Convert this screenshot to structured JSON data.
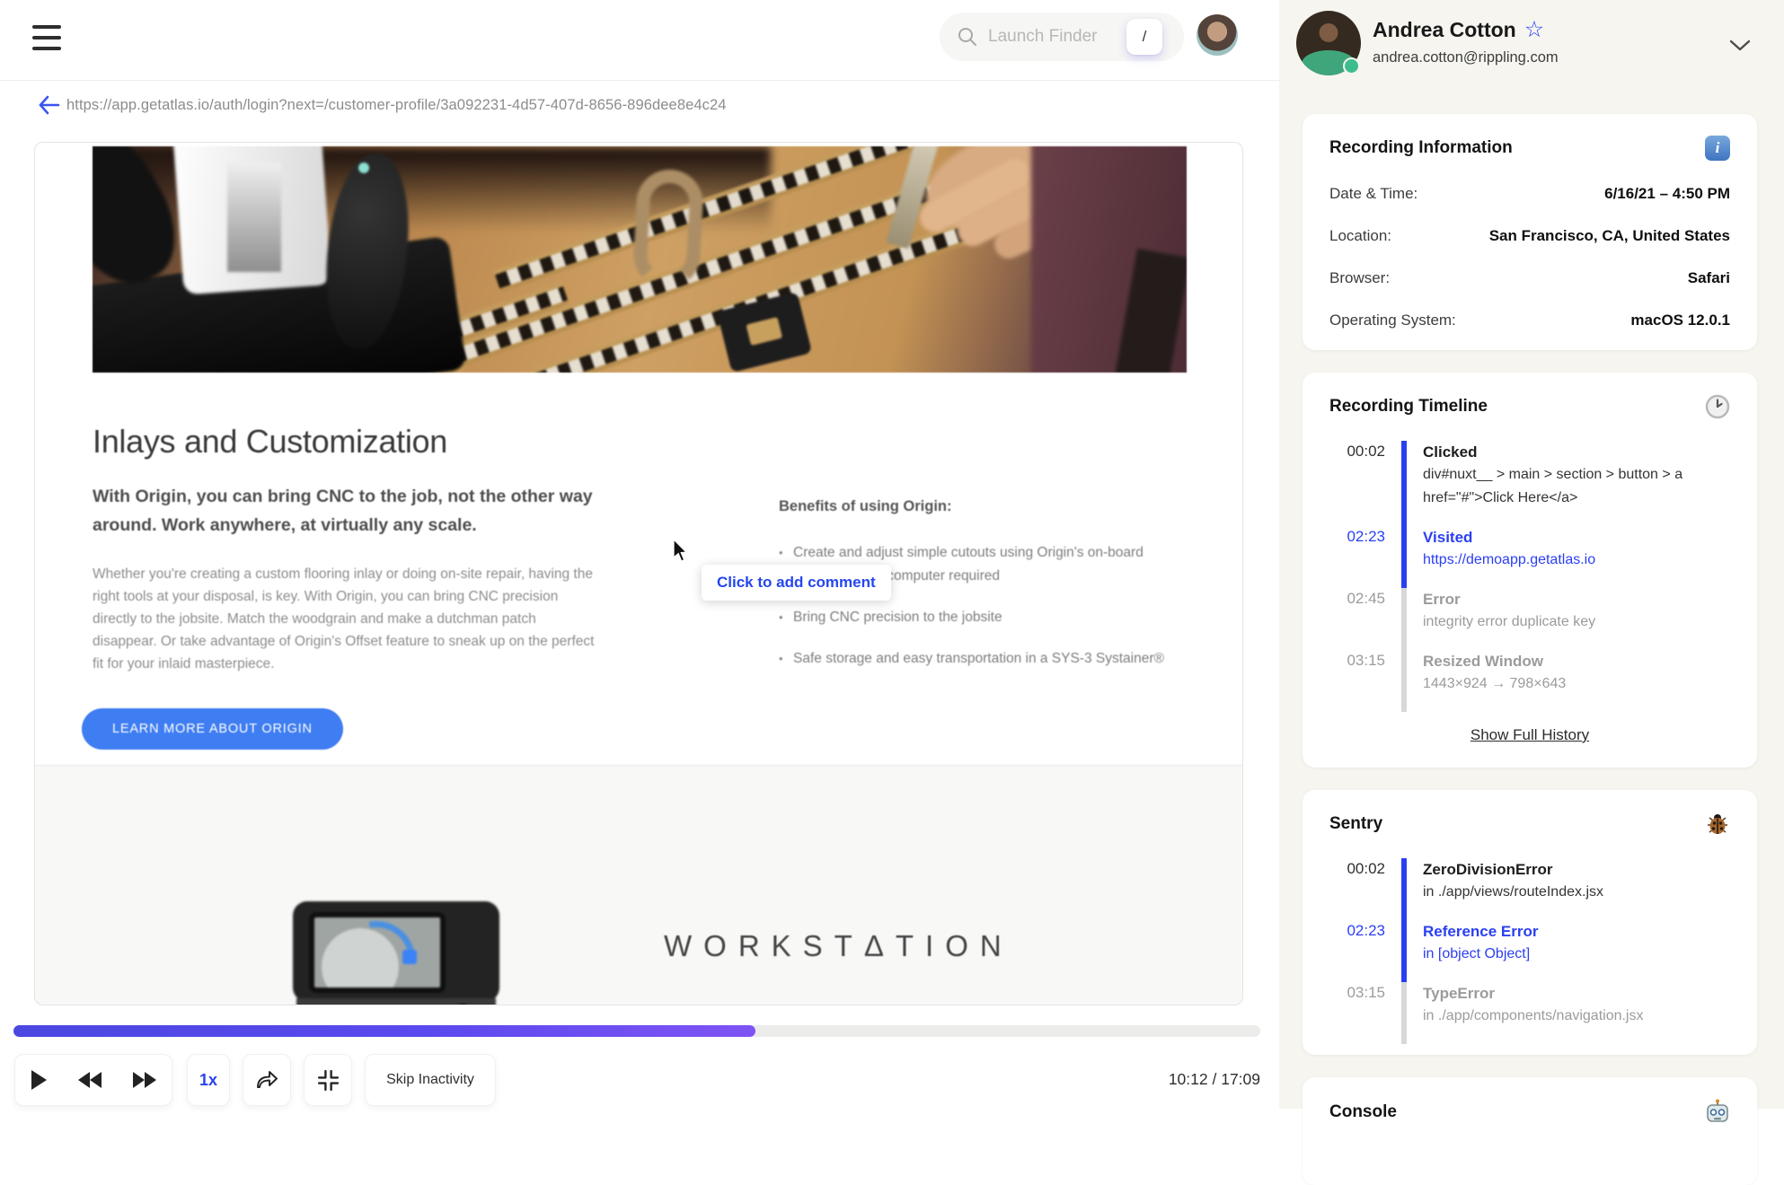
{
  "topbar": {
    "search_placeholder": "Launch Finder",
    "search_shortcut_key": "/"
  },
  "url_bar": {
    "url": "https://app.getatlas.io/auth/login?next=/customer-profile/3a092231-4d57-407d-8656-896dee8e4c24"
  },
  "replay": {
    "heading": "Inlays and Customization",
    "intro": "With Origin, you can bring CNC to the job, not the other way around. Work anywhere, at virtually any scale.",
    "body": "Whether you're creating a custom flooring inlay or doing on-site repair, having the right tools at your disposal, is key. With Origin, you can bring CNC precision directly to the jobsite. Match the woodgrain and make a dutchman patch disappear. Or take advantage of Origin's Offset feature to sneak up on the perfect fit for your inlaid masterpiece.",
    "benefits_heading": "Benefits of using Origin:",
    "benefits": [
      "Create and adjust simple cutouts using Origin's on-board software — no computer required",
      "Bring CNC precision to the jobsite",
      "Safe storage and easy transportation in a SYS-3 Systainer®"
    ],
    "cta_label": "LEARN MORE ABOUT ORIGIN",
    "brand_logo": "WORKSTΔTION",
    "comment_tooltip": "Click to add comment"
  },
  "playback": {
    "speed": "1x",
    "skip_inactivity_label": "Skip Inactivity",
    "time_display": "10:12 / 17:09",
    "progress_percent": 59.5
  },
  "sidebar": {
    "user": {
      "name": "Andrea Cotton",
      "email": "andrea.cotton@rippling.com",
      "favorite_star": "☆",
      "status": "online"
    },
    "recording_info": {
      "title": "Recording Information",
      "icon": "info-emoji",
      "rows": [
        {
          "label": "Date & Time:",
          "value": "6/16/21 – 4:50 PM"
        },
        {
          "label": "Location:",
          "value": "San Francisco, CA, United States"
        },
        {
          "label": "Browser:",
          "value": "Safari"
        },
        {
          "label": "Operating System:",
          "value": "macOS 12.0.1"
        }
      ]
    },
    "timeline": {
      "title": "Recording Timeline",
      "icon": "clock-emoji",
      "events": [
        {
          "time": "00:02",
          "label": "Clicked",
          "detail": "div#nuxt__ > main > section > button > a href=\"#\">Click Here</a>",
          "state": "past"
        },
        {
          "time": "02:23",
          "label": "Visited",
          "detail": "https://demoapp.getatlas.io",
          "state": "current"
        },
        {
          "time": "02:45",
          "label": "Error",
          "detail": "integrity error duplicate key",
          "state": "future"
        },
        {
          "time": "03:15",
          "label": "Resized Window",
          "detail": "1443×924 → 798×643",
          "state": "future"
        }
      ],
      "show_more_label": "Show Full History"
    },
    "sentry": {
      "title": "Sentry",
      "icon": "ladybug-emoji",
      "events": [
        {
          "time": "00:02",
          "label": "ZeroDivisionError",
          "detail": "in ./app/views/routeIndex.jsx",
          "state": "past"
        },
        {
          "time": "02:23",
          "label": "Reference Error",
          "detail": "in [object Object]",
          "state": "current"
        },
        {
          "time": "03:15",
          "label": "TypeError",
          "detail": "in ./app/components/navigation.jsx",
          "state": "future"
        }
      ]
    },
    "console": {
      "title": "Console",
      "icon": "robot-emoji"
    }
  },
  "colors": {
    "accent_blue": "#2b3ff2",
    "cta_blue": "#3f7df2",
    "tooltip_blue": "#2546ef",
    "progress_gradient_start": "#4b47e0",
    "progress_gradient_end": "#7f53f3",
    "muted_gray": "#9b9b9b",
    "sidebar_bg": "#f6f5ef",
    "status_green": "#3dbd8d"
  }
}
